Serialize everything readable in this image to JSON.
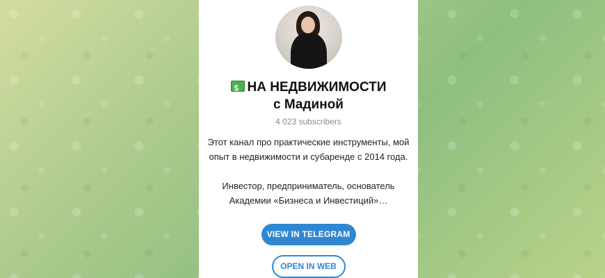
{
  "channel": {
    "title_line1": "НА НЕДВИЖИМОСТИ",
    "title_line2": "с Мадиной",
    "subscribers": "4 023 subscribers",
    "description_line1": "Этот канал про практические инструменты, мой опыт в недвижимости и субаренде с 2014 года.",
    "description_line2": "Инвестор, предприниматель, основатель Академии «Бизнеса и Инвестиций»…",
    "title_icon": "money-icon"
  },
  "actions": {
    "view_in_telegram": "VIEW IN TELEGRAM",
    "open_in_web": "OPEN IN WEB"
  },
  "colors": {
    "accent": "#2f87d1",
    "background_green": "#8fbf80"
  }
}
